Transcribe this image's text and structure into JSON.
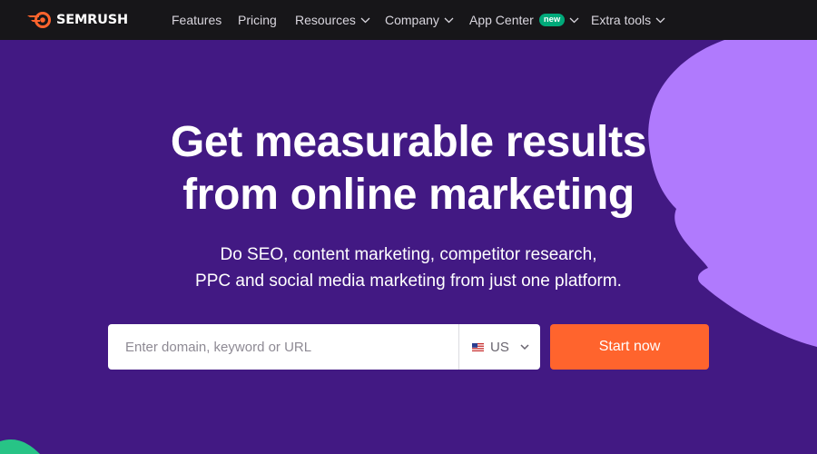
{
  "brand": {
    "name": "SEMRUSH",
    "logo_icon": "semrush-fire-icon",
    "logo_color": "#ff642d"
  },
  "nav": {
    "items": [
      {
        "label": "Features",
        "dropdown": false
      },
      {
        "label": "Pricing",
        "dropdown": false
      },
      {
        "label": "Resources",
        "dropdown": true
      },
      {
        "label": "Company",
        "dropdown": true
      },
      {
        "label": "App Center",
        "dropdown": true,
        "badge": "new"
      },
      {
        "label": "Extra tools",
        "dropdown": true
      }
    ]
  },
  "hero": {
    "title_line1": "Get measurable results",
    "title_line2": "from online marketing",
    "subtitle_line1": "Do SEO, content marketing, competitor research,",
    "subtitle_line2": "PPC and social media marketing from just one platform."
  },
  "search": {
    "placeholder": "Enter domain, keyword or URL",
    "value": "",
    "region": {
      "label": "US",
      "flag_icon": "us-flag-icon"
    }
  },
  "cta": {
    "label": "Start now"
  },
  "colors": {
    "background": "#421983",
    "nav_background": "#171619",
    "accent": "#ff642d",
    "decor_purple": "#b07afd",
    "decor_green": "#27c486",
    "badge_green": "#00a97a"
  }
}
